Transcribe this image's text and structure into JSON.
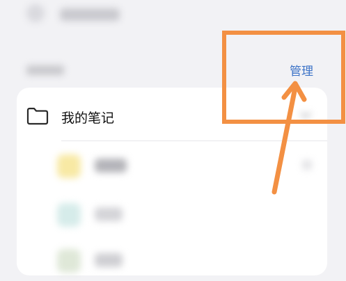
{
  "section": {
    "manage_label": "管理"
  },
  "folder": {
    "title": "我的笔记",
    "icon": "folder-icon",
    "expand_icon": "chevron-down-icon"
  },
  "annotation": {
    "color": "#f39043",
    "shapes": [
      "highlight-box",
      "pointer-arrow"
    ]
  },
  "colors": {
    "accent": "#3c73c7",
    "background": "#f2f2f5",
    "card": "#ffffff"
  }
}
